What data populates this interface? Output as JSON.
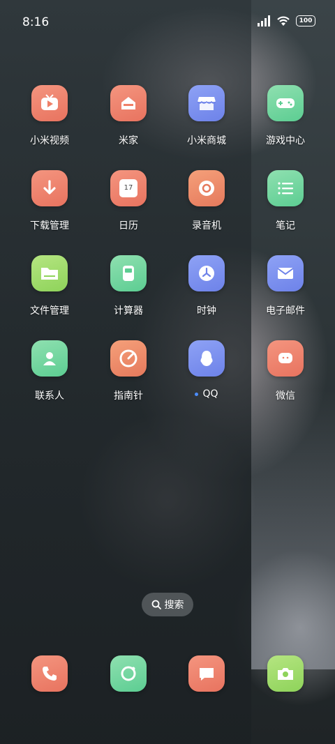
{
  "status_bar": {
    "time": "8:16",
    "battery": "100"
  },
  "apps": [
    {
      "label": "小米视频",
      "icon": "video-play-icon",
      "color": "#ef8068"
    },
    {
      "label": "米家",
      "icon": "home-icon",
      "color": "#ef8068"
    },
    {
      "label": "小米商城",
      "icon": "store-icon",
      "color": "#7d92ef"
    },
    {
      "label": "游戏中心",
      "icon": "gamepad-icon",
      "color": "#6fd69e"
    },
    {
      "label": "下载管理",
      "icon": "download-arrow-icon",
      "color": "#ef8068"
    },
    {
      "label": "日历",
      "icon": "calendar-icon",
      "calendar_day": "17",
      "color": "#ef8068"
    },
    {
      "label": "录音机",
      "icon": "record-icon",
      "color": "#ef8068"
    },
    {
      "label": "笔记",
      "icon": "notes-list-icon",
      "color": "#6fd69e"
    },
    {
      "label": "文件管理",
      "icon": "folder-icon",
      "color": "#9fdc6d"
    },
    {
      "label": "计算器",
      "icon": "calculator-icon",
      "color": "#6fd69e"
    },
    {
      "label": "时钟",
      "icon": "clock-icon",
      "color": "#7d92ef"
    },
    {
      "label": "电子邮件",
      "icon": "mail-icon",
      "color": "#7d92ef"
    },
    {
      "label": "联系人",
      "icon": "contact-person-icon",
      "color": "#6fd69e"
    },
    {
      "label": "指南针",
      "icon": "compass-icon",
      "color": "#ef8068"
    },
    {
      "label": "QQ",
      "icon": "qq-penguin-icon",
      "color": "#7d92ef"
    },
    {
      "label": "微信",
      "icon": "wechat-chat-icon",
      "color": "#ef8068"
    }
  ],
  "search": {
    "label": "搜索",
    "icon": "search-icon"
  },
  "dock": [
    {
      "icon": "phone-icon"
    },
    {
      "icon": "browser-icon"
    },
    {
      "icon": "message-icon"
    },
    {
      "icon": "camera-icon"
    }
  ]
}
